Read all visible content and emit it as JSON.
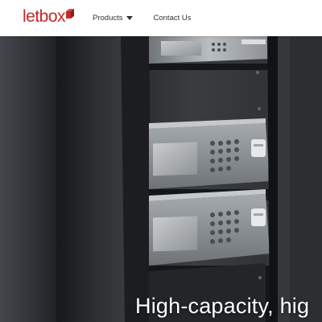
{
  "brand": {
    "name": "letbox"
  },
  "nav": {
    "items": [
      {
        "label": "Products",
        "has_dropdown": true
      },
      {
        "label": "Contact Us",
        "has_dropdown": false
      }
    ]
  },
  "hero": {
    "title": "High-capacity, hig"
  },
  "colors": {
    "brand_red": "#c62828",
    "nav_text": "#333333",
    "header_bg": "#ffffff",
    "hero_bg": "#2a2d31"
  },
  "icons": [
    "caret-down-icon",
    "logo-box-icon"
  ]
}
